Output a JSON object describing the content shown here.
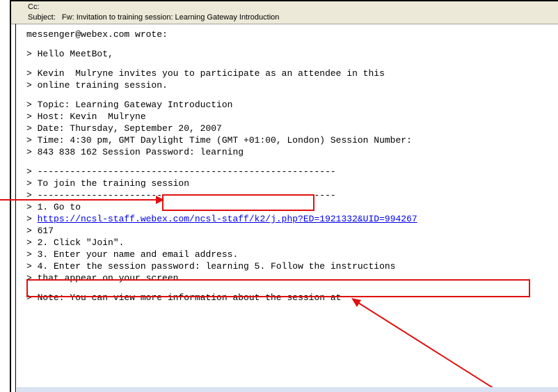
{
  "header": {
    "cc_label": "Cc:",
    "subject_label": "Subject:",
    "subject_value": "Fw: Invitation to training session: Learning Gateway Introduction"
  },
  "email": {
    "lines": [
      "messenger@webex.com wrote:",
      "",
      "> Hello MeetBot,",
      "",
      "> Kevin  Mulryne invites you to participate as an attendee in this",
      "> online training session.",
      "",
      "> Topic: Learning Gateway Introduction",
      "> Host: Kevin  Mulryne",
      "> Date: Thursday, September 20, 2007",
      "> Time: 4:30 pm, GMT Daylight Time (GMT +01:00, London) Session Number:",
      "> 843 838 162 Session Password: learning",
      "",
      "> -------------------------------------------------------",
      "> To join the training session",
      "> -------------------------------------------------------",
      "> 1. Go to",
      "> ",
      "> 617",
      "> 2. Click \"Join\".",
      "> 3. Enter your name and email address.",
      "> 4. Enter the session password: learning 5. Follow the instructions",
      "> that appear on your screen.",
      "",
      "> Note: You can view more information about the session at"
    ],
    "link_text": "https://ncsl-staff.webex.com/ncsl-staff/k2/j.php?ED=1921332&UID=994267"
  },
  "colors": {
    "callout": "#e01010",
    "link": "#0000ee",
    "header_bg": "#ece9d8"
  }
}
